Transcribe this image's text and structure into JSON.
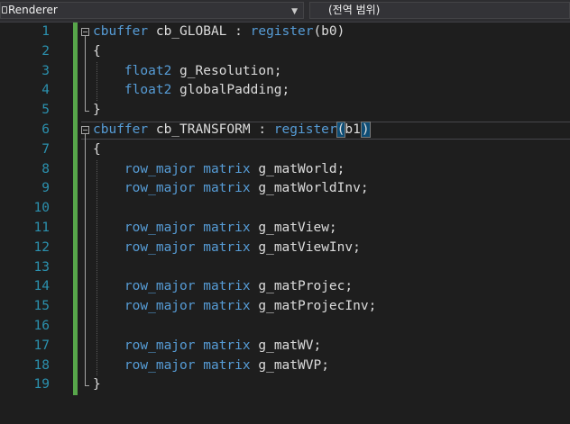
{
  "navbar": {
    "project_label": "Renderer",
    "scope_label": "(전역 범위)"
  },
  "icons": {
    "project": "project-icon",
    "dropdown": "chevron-down-icon",
    "outlining": "collapse-outline-icon"
  },
  "colors": {
    "background": "#1e1e1e",
    "line_number": "#2b91af",
    "keyword": "#569cd6",
    "text": "#dcdcdc",
    "change_marker": "#57a64a"
  },
  "editor": {
    "cursor_line": 6,
    "lines": [
      {
        "num": "1",
        "tokens": [
          {
            "k": "kw",
            "t": "cbuffer"
          },
          {
            "k": "p",
            "t": " cb_GLOBAL : "
          },
          {
            "k": "kw",
            "t": "register"
          },
          {
            "k": "p",
            "t": "(b0)"
          }
        ]
      },
      {
        "num": "2",
        "tokens": [
          {
            "k": "p",
            "t": "{"
          }
        ]
      },
      {
        "num": "3",
        "tokens": [
          {
            "k": "p",
            "t": "    "
          },
          {
            "k": "kw",
            "t": "float2"
          },
          {
            "k": "p",
            "t": " g_Resolution;"
          }
        ]
      },
      {
        "num": "4",
        "tokens": [
          {
            "k": "p",
            "t": "    "
          },
          {
            "k": "kw",
            "t": "float2"
          },
          {
            "k": "p",
            "t": " globalPadding;"
          }
        ]
      },
      {
        "num": "5",
        "tokens": [
          {
            "k": "p",
            "t": "}"
          }
        ]
      },
      {
        "num": "6",
        "tokens": [
          {
            "k": "kw",
            "t": "cbuffer"
          },
          {
            "k": "p",
            "t": " cb_TRANSFORM : "
          },
          {
            "k": "kw",
            "t": "register"
          },
          {
            "k": "hl",
            "t": "("
          },
          {
            "k": "p",
            "t": "b1"
          },
          {
            "k": "cur",
            "t": ""
          },
          {
            "k": "hl",
            "t": ")"
          }
        ]
      },
      {
        "num": "7",
        "tokens": [
          {
            "k": "p",
            "t": "{"
          }
        ]
      },
      {
        "num": "8",
        "tokens": [
          {
            "k": "p",
            "t": "    "
          },
          {
            "k": "kw",
            "t": "row_major"
          },
          {
            "k": "p",
            "t": " "
          },
          {
            "k": "kw",
            "t": "matrix"
          },
          {
            "k": "p",
            "t": " g_matWorld;"
          }
        ]
      },
      {
        "num": "9",
        "tokens": [
          {
            "k": "p",
            "t": "    "
          },
          {
            "k": "kw",
            "t": "row_major"
          },
          {
            "k": "p",
            "t": " "
          },
          {
            "k": "kw",
            "t": "matrix"
          },
          {
            "k": "p",
            "t": " g_matWorldInv;"
          }
        ]
      },
      {
        "num": "10",
        "tokens": []
      },
      {
        "num": "11",
        "tokens": [
          {
            "k": "p",
            "t": "    "
          },
          {
            "k": "kw",
            "t": "row_major"
          },
          {
            "k": "p",
            "t": " "
          },
          {
            "k": "kw",
            "t": "matrix"
          },
          {
            "k": "p",
            "t": " g_matView;"
          }
        ]
      },
      {
        "num": "12",
        "tokens": [
          {
            "k": "p",
            "t": "    "
          },
          {
            "k": "kw",
            "t": "row_major"
          },
          {
            "k": "p",
            "t": " "
          },
          {
            "k": "kw",
            "t": "matrix"
          },
          {
            "k": "p",
            "t": " g_matViewInv;"
          }
        ]
      },
      {
        "num": "13",
        "tokens": []
      },
      {
        "num": "14",
        "tokens": [
          {
            "k": "p",
            "t": "    "
          },
          {
            "k": "kw",
            "t": "row_major"
          },
          {
            "k": "p",
            "t": " "
          },
          {
            "k": "kw",
            "t": "matrix"
          },
          {
            "k": "p",
            "t": " g_matProjec;"
          }
        ]
      },
      {
        "num": "15",
        "tokens": [
          {
            "k": "p",
            "t": "    "
          },
          {
            "k": "kw",
            "t": "row_major"
          },
          {
            "k": "p",
            "t": " "
          },
          {
            "k": "kw",
            "t": "matrix"
          },
          {
            "k": "p",
            "t": " g_matProjecInv;"
          }
        ]
      },
      {
        "num": "16",
        "tokens": []
      },
      {
        "num": "17",
        "tokens": [
          {
            "k": "p",
            "t": "    "
          },
          {
            "k": "kw",
            "t": "row_major"
          },
          {
            "k": "p",
            "t": " "
          },
          {
            "k": "kw",
            "t": "matrix"
          },
          {
            "k": "p",
            "t": " g_matWV;"
          }
        ]
      },
      {
        "num": "18",
        "tokens": [
          {
            "k": "p",
            "t": "    "
          },
          {
            "k": "kw",
            "t": "row_major"
          },
          {
            "k": "p",
            "t": " "
          },
          {
            "k": "kw",
            "t": "matrix"
          },
          {
            "k": "p",
            "t": " g_matWVP;"
          }
        ]
      },
      {
        "num": "19",
        "tokens": [
          {
            "k": "p",
            "t": "}"
          }
        ]
      }
    ]
  }
}
